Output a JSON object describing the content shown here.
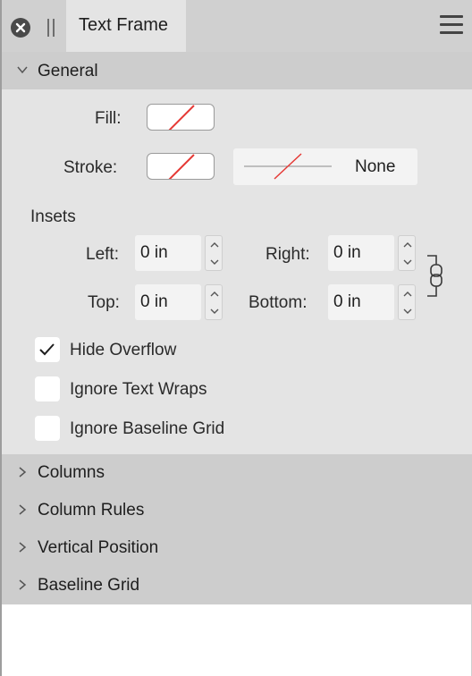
{
  "header": {
    "tab_label": "Text Frame",
    "icons": [
      "close-icon",
      "drag-grip-icon",
      "hamburger-menu-icon"
    ]
  },
  "general": {
    "title": "General",
    "fill_label": "Fill:",
    "stroke_label": "Stroke:",
    "stroke_style_value": "None",
    "insets_label": "Insets",
    "left_label": "Left:",
    "left_value": "0 in",
    "right_label": "Right:",
    "right_value": "0 in",
    "top_label": "Top:",
    "top_value": "0 in",
    "bottom_label": "Bottom:",
    "bottom_value": "0 in",
    "checkboxes": [
      {
        "label": "Hide Overflow",
        "checked": true
      },
      {
        "label": "Ignore Text Wraps",
        "checked": false
      },
      {
        "label": "Ignore Baseline Grid",
        "checked": false
      }
    ]
  },
  "sections": [
    {
      "label": "Columns"
    },
    {
      "label": "Column Rules"
    },
    {
      "label": "Vertical Position"
    },
    {
      "label": "Baseline Grid"
    }
  ],
  "colors": {
    "no_color_slash": "#e53935",
    "header_bg": "#d0d0d0",
    "body_bg": "#e4e4e4"
  }
}
